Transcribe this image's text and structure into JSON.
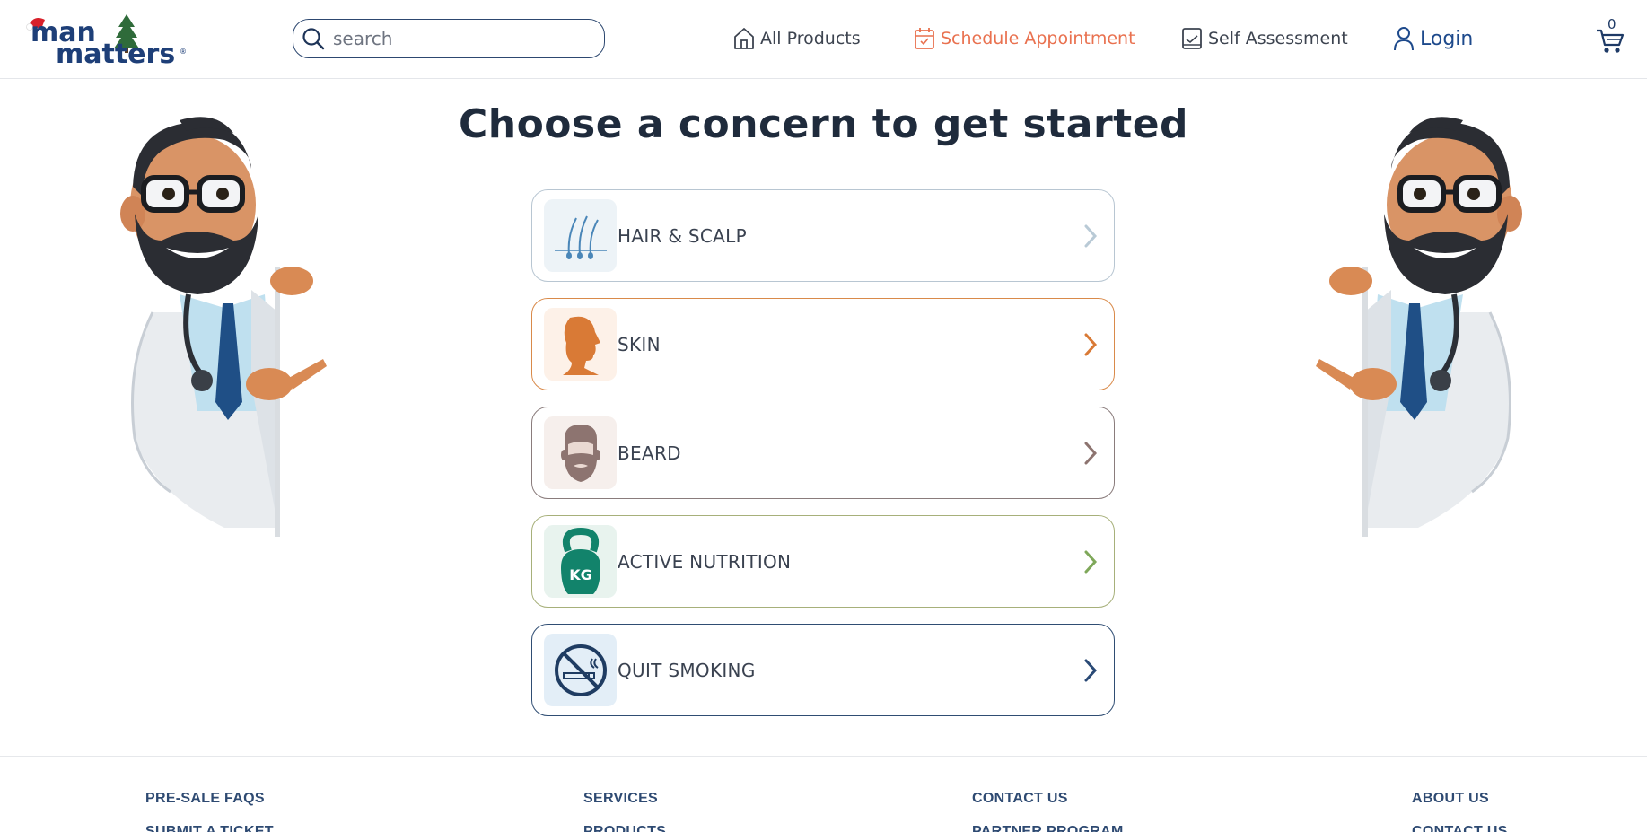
{
  "header": {
    "logo_text_line1": "man",
    "logo_text_line2": "matters",
    "search": {
      "placeholder": "search"
    },
    "nav": {
      "all_products": "All Products",
      "schedule_appointment": "Schedule Appointment",
      "self_assessment": "Self Assessment",
      "login": "Login"
    },
    "cart_count": "0"
  },
  "main": {
    "title": "Choose a concern to get started",
    "concerns": [
      {
        "label": "HAIR & SCALP",
        "icon": "hair-follicle-icon",
        "border": "#b8c6d2",
        "thumb_bg": "#edf3f7",
        "chevron": "#b9cad6"
      },
      {
        "label": "SKIN",
        "icon": "face-profile-icon",
        "border": "#d98a4a",
        "thumb_bg": "#fdf1e8",
        "chevron": "#d97a36"
      },
      {
        "label": "BEARD",
        "icon": "beard-face-icon",
        "border": "#8a7c7c",
        "thumb_bg": "#f6efec",
        "chevron": "#8d7470"
      },
      {
        "label": "ACTIVE NUTRITION",
        "icon": "kettlebell-icon",
        "icon_text": "KG",
        "border": "#a7b07a",
        "thumb_bg": "#e8f3ee",
        "chevron": "#7fa85a"
      },
      {
        "label": "QUIT SMOKING",
        "icon": "no-smoking-icon",
        "border": "#2f4d73",
        "thumb_bg": "#e3eef7",
        "chevron": "#2a4a76"
      }
    ]
  },
  "footer": {
    "col1": [
      "PRE-SALE FAQS",
      "SUBMIT A TICKET"
    ],
    "col2": [
      "SERVICES",
      "PRODUCTS"
    ],
    "col3": [
      "CONTACT US",
      "PARTNER PROGRAM"
    ],
    "col4": [
      "ABOUT US",
      "CONTACT US"
    ]
  },
  "colors": {
    "accent_orange": "#e9714f",
    "brand_navy": "#1e4a8c",
    "title": "#1f2b3c"
  }
}
